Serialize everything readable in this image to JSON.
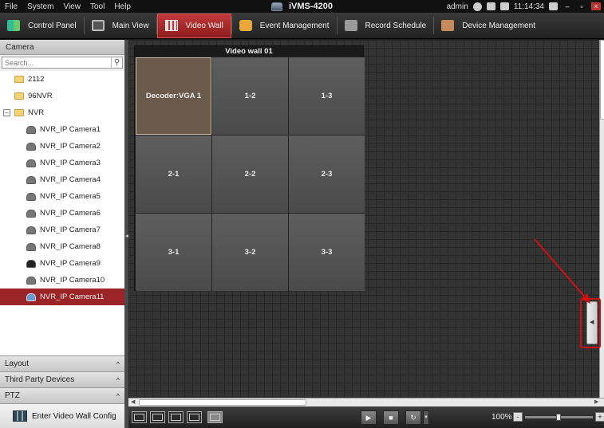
{
  "menubar": {
    "menus": [
      "File",
      "System",
      "View",
      "Tool",
      "Help"
    ],
    "app_title": "iVMS-4200",
    "user": "admin",
    "time": "11:14:34"
  },
  "toolbar": {
    "items": [
      {
        "label": "Control Panel",
        "icon": "control-panel-icon"
      },
      {
        "label": "Main View",
        "icon": "main-view-icon"
      },
      {
        "label": "Video Wall",
        "icon": "video-wall-icon",
        "active": true
      },
      {
        "label": "Event Management",
        "icon": "event-management-icon"
      },
      {
        "label": "Record Schedule",
        "icon": "record-schedule-icon"
      },
      {
        "label": "Device Management",
        "icon": "device-management-icon"
      }
    ]
  },
  "camera_panel": {
    "header": "Camera",
    "search_placeholder": "Search...",
    "tree": [
      {
        "label": "2112",
        "type": "folder"
      },
      {
        "label": "96NVR",
        "type": "folder"
      },
      {
        "label": "NVR",
        "type": "folder-expanded"
      },
      {
        "label": "NVR_IP Camera1",
        "type": "camera"
      },
      {
        "label": "NVR_IP Camera2",
        "type": "camera"
      },
      {
        "label": "NVR_IP Camera3",
        "type": "camera"
      },
      {
        "label": "NVR_IP Camera4",
        "type": "camera"
      },
      {
        "label": "NVR_IP Camera5",
        "type": "camera"
      },
      {
        "label": "NVR_IP Camera6",
        "type": "camera"
      },
      {
        "label": "NVR_IP Camera7",
        "type": "camera"
      },
      {
        "label": "NVR_IP Camera8",
        "type": "camera"
      },
      {
        "label": "NVR_IP Camera9",
        "type": "camera-dark"
      },
      {
        "label": "NVR_IP Camera10",
        "type": "camera"
      },
      {
        "label": "NVR_IP Camera11",
        "type": "camera-selected"
      }
    ]
  },
  "sections": [
    "Layout",
    "Third Party Devices",
    "PTZ"
  ],
  "footer": {
    "config_label": "Enter Video Wall Config"
  },
  "video_wall": {
    "title": "Video wall 01",
    "cells": [
      "Decoder:VGA 1",
      "1-2",
      "1-3",
      "2-1",
      "2-2",
      "2-3",
      "3-1",
      "3-2",
      "3-3"
    ]
  },
  "bottom": {
    "zoom": "100%",
    "zoom_minus": "-",
    "zoom_plus": "+"
  },
  "colors": {
    "accent": "#9b2526",
    "annotation": "#d01010"
  }
}
